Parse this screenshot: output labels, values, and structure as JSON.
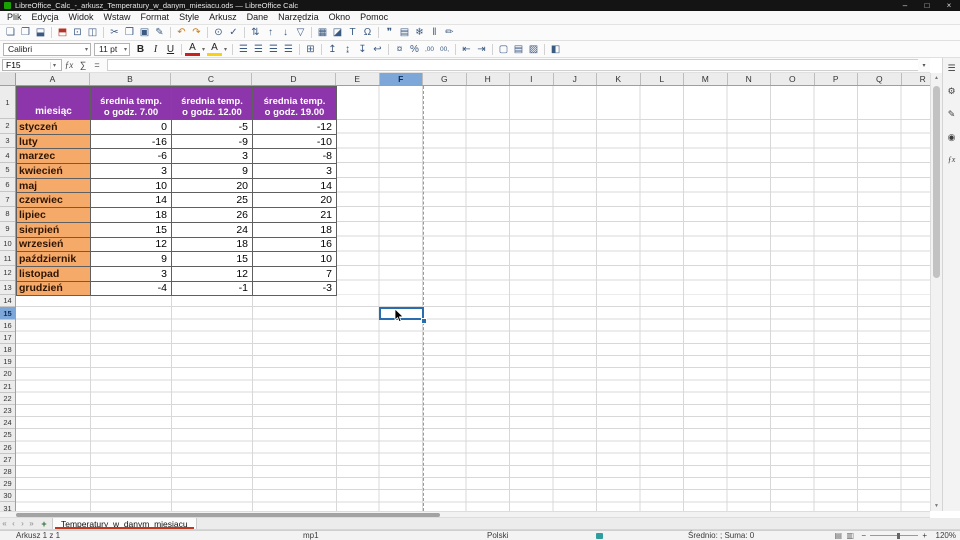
{
  "window": {
    "title": "LibreOffice_Calc_-_arkusz_Temperatury_w_danym_miesiacu.ods — LibreOffice Calc",
    "minimize": "–",
    "maximize": "□",
    "close": "×"
  },
  "menu": {
    "items": [
      "Plik",
      "Edycja",
      "Widok",
      "Wstaw",
      "Format",
      "Style",
      "Arkusz",
      "Dane",
      "Narzędzia",
      "Okno",
      "Pomoc"
    ]
  },
  "toolbar_main": {
    "items": [
      {
        "name": "new-document-icon",
        "glyph": "❏",
        "cls": "tbi",
        "i": "true"
      },
      {
        "name": "open-document-icon",
        "glyph": "❐",
        "cls": "tbi",
        "i": "true"
      },
      {
        "name": "save-document-icon",
        "glyph": "⬓",
        "cls": "tbi",
        "i": "true"
      },
      {
        "name": "separator",
        "glyph": "",
        "cls": "tbsep",
        "i": "false"
      },
      {
        "name": "export-pdf-icon",
        "glyph": "⬒",
        "cls": "tbi red",
        "i": "true"
      },
      {
        "name": "print-icon",
        "glyph": "⊡",
        "cls": "tbi",
        "i": "true"
      },
      {
        "name": "print-preview-icon",
        "glyph": "◫",
        "cls": "tbi",
        "i": "true"
      },
      {
        "name": "separator",
        "glyph": "",
        "cls": "tbsep",
        "i": "false"
      },
      {
        "name": "cut-icon",
        "glyph": "✂",
        "cls": "tbi",
        "i": "true"
      },
      {
        "name": "copy-icon",
        "glyph": "❒",
        "cls": "tbi",
        "i": "true"
      },
      {
        "name": "paste-icon",
        "glyph": "▣",
        "cls": "tbi",
        "i": "true"
      },
      {
        "name": "clone-formatting-icon",
        "glyph": "✎",
        "cls": "tbi",
        "i": "true"
      },
      {
        "name": "separator",
        "glyph": "",
        "cls": "tbsep",
        "i": "false"
      },
      {
        "name": "undo-icon",
        "glyph": "↶",
        "cls": "tbi amber",
        "i": "true"
      },
      {
        "name": "redo-icon",
        "glyph": "↷",
        "cls": "tbi amber",
        "i": "true"
      },
      {
        "name": "separator",
        "glyph": "",
        "cls": "tbsep",
        "i": "false"
      },
      {
        "name": "find-and-replace-icon",
        "glyph": "⊙",
        "cls": "tbi",
        "i": "true"
      },
      {
        "name": "spelling-icon",
        "glyph": "✓",
        "cls": "tbi",
        "i": "true"
      },
      {
        "name": "separator",
        "glyph": "",
        "cls": "tbsep",
        "i": "false"
      },
      {
        "name": "sort-icon",
        "glyph": "⇅",
        "cls": "tbi",
        "i": "true"
      },
      {
        "name": "sort-ascending-icon",
        "glyph": "↑",
        "cls": "tbi",
        "i": "true"
      },
      {
        "name": "sort-descending-icon",
        "glyph": "↓",
        "cls": "tbi",
        "i": "true"
      },
      {
        "name": "autofilter-icon",
        "glyph": "▽",
        "cls": "tbi",
        "i": "true"
      },
      {
        "name": "separator",
        "glyph": "",
        "cls": "tbsep",
        "i": "false"
      },
      {
        "name": "insert-image-icon",
        "glyph": "▦",
        "cls": "tbi",
        "i": "true"
      },
      {
        "name": "insert-chart-icon",
        "glyph": "◪",
        "cls": "tbi",
        "i": "true"
      },
      {
        "name": "insert-text-box-icon",
        "glyph": "T",
        "cls": "tbi",
        "i": "true"
      },
      {
        "name": "insert-special-character-icon",
        "glyph": "Ω",
        "cls": "tbi",
        "i": "true"
      },
      {
        "name": "separator",
        "glyph": "",
        "cls": "tbsep",
        "i": "false"
      },
      {
        "name": "insert-comment-icon",
        "glyph": "❞",
        "cls": "tbi",
        "i": "true"
      },
      {
        "name": "headers-and-footers-icon",
        "glyph": "▤",
        "cls": "tbi",
        "i": "true"
      },
      {
        "name": "freeze-rows-and-columns-icon",
        "glyph": "❄",
        "cls": "tbi",
        "i": "true"
      },
      {
        "name": "split-window-icon",
        "glyph": "‖",
        "cls": "tbi",
        "i": "true"
      },
      {
        "name": "show-draw-functions-icon",
        "glyph": "✏",
        "cls": "tbi",
        "i": "true"
      }
    ]
  },
  "toolbar_format": {
    "font_name": "Calibri",
    "font_size": "11 pt",
    "dropdown_arrow": "▾",
    "items": [
      {
        "name": "bold-icon",
        "glyph": "B",
        "cls": "tbi b",
        "i": "true"
      },
      {
        "name": "italic-icon",
        "glyph": "I",
        "cls": "tbi it",
        "i": "true"
      },
      {
        "name": "underline-icon",
        "glyph": "U",
        "cls": "tbi un",
        "i": "true"
      },
      {
        "name": "separator",
        "glyph": "",
        "cls": "tbsep",
        "i": "false"
      },
      {
        "name": "font-color-icon",
        "glyph": "A",
        "cls": "tbi fc",
        "i": "true"
      },
      {
        "name": "font-color-dropdown",
        "glyph": "▾",
        "cls": "tbarr",
        "i": "true"
      },
      {
        "name": "highlighting-color-icon",
        "glyph": "A",
        "cls": "tbi hl",
        "i": "true"
      },
      {
        "name": "highlighting-color-dropdown",
        "glyph": "▾",
        "cls": "tbarr",
        "i": "true"
      },
      {
        "name": "separator",
        "glyph": "",
        "cls": "tbsep",
        "i": "false"
      },
      {
        "name": "align-left-icon",
        "glyph": "☰",
        "cls": "tbi",
        "i": "true"
      },
      {
        "name": "align-center-icon",
        "glyph": "☰",
        "cls": "tbi",
        "i": "true"
      },
      {
        "name": "align-right-icon",
        "glyph": "☰",
        "cls": "tbi",
        "i": "true"
      },
      {
        "name": "justified-icon",
        "glyph": "☰",
        "cls": "tbi",
        "i": "true"
      },
      {
        "name": "separator",
        "glyph": "",
        "cls": "tbsep",
        "i": "false"
      },
      {
        "name": "merge-cells-icon",
        "glyph": "⊞",
        "cls": "tbi",
        "i": "true"
      },
      {
        "name": "separator",
        "glyph": "",
        "cls": "tbsep",
        "i": "false"
      },
      {
        "name": "align-top-icon",
        "glyph": "↥",
        "cls": "tbi",
        "i": "true"
      },
      {
        "name": "center-vertically-icon",
        "glyph": "↨",
        "cls": "tbi",
        "i": "true"
      },
      {
        "name": "align-bottom-icon",
        "glyph": "↧",
        "cls": "tbi",
        "i": "true"
      },
      {
        "name": "wrap-text-icon",
        "glyph": "↩",
        "cls": "tbi",
        "i": "true"
      },
      {
        "name": "separator",
        "glyph": "",
        "cls": "tbsep",
        "i": "false"
      },
      {
        "name": "format-as-currency-icon",
        "glyph": "¤",
        "cls": "tbi",
        "i": "true"
      },
      {
        "name": "format-as-percent-icon",
        "glyph": "%",
        "cls": "tbi",
        "i": "true"
      },
      {
        "name": "add-decimal-place-icon",
        "glyph": ",00",
        "cls": "tbi sm",
        "i": "true"
      },
      {
        "name": "delete-decimal-place-icon",
        "glyph": "00,",
        "cls": "tbi sm",
        "i": "true"
      },
      {
        "name": "separator",
        "glyph": "",
        "cls": "tbsep",
        "i": "false"
      },
      {
        "name": "decrease-indent-icon",
        "glyph": "⇤",
        "cls": "tbi",
        "i": "true"
      },
      {
        "name": "increase-indent-icon",
        "glyph": "⇥",
        "cls": "tbi",
        "i": "true"
      },
      {
        "name": "separator",
        "glyph": "",
        "cls": "tbsep",
        "i": "false"
      },
      {
        "name": "borders-icon",
        "glyph": "▢",
        "cls": "tbi",
        "i": "true"
      },
      {
        "name": "border-style-icon",
        "glyph": "▤",
        "cls": "tbi",
        "i": "true"
      },
      {
        "name": "border-color-icon",
        "glyph": "▨",
        "cls": "tbi",
        "i": "true"
      },
      {
        "name": "separator",
        "glyph": "",
        "cls": "tbsep",
        "i": "false"
      },
      {
        "name": "conditional-formatting-icon",
        "glyph": "◧",
        "cls": "tbi",
        "i": "true"
      }
    ]
  },
  "formula_bar": {
    "name_box": "F15",
    "dropdown_arrow": "▾",
    "function_wizard": "ƒx",
    "sum": "∑",
    "formula": "=",
    "input_value": "",
    "expand_arrow": "▾"
  },
  "grid": {
    "cols_abcd": [
      "A",
      "B",
      "C",
      "D"
    ],
    "cols_uniform": [
      {
        "label": "E",
        "cls": "ch u",
        "name": "column-header-E"
      },
      {
        "label": "F",
        "cls": "ch u sel",
        "name": "column-header-F"
      },
      {
        "label": "G",
        "cls": "ch u",
        "name": "column-header-G"
      },
      {
        "label": "H",
        "cls": "ch u",
        "name": "column-header-H"
      },
      {
        "label": "I",
        "cls": "ch u",
        "name": "column-header-I"
      },
      {
        "label": "J",
        "cls": "ch u",
        "name": "column-header-J"
      },
      {
        "label": "K",
        "cls": "ch u",
        "name": "column-header-K"
      },
      {
        "label": "L",
        "cls": "ch u",
        "name": "column-header-L"
      },
      {
        "label": "M",
        "cls": "ch u",
        "name": "column-header-M"
      },
      {
        "label": "N",
        "cls": "ch u",
        "name": "column-header-N"
      },
      {
        "label": "O",
        "cls": "ch u",
        "name": "column-header-O"
      },
      {
        "label": "P",
        "cls": "ch u",
        "name": "column-header-P"
      },
      {
        "label": "Q",
        "cls": "ch u",
        "name": "column-header-Q"
      },
      {
        "label": "R",
        "cls": "ch u",
        "name": "column-header-R"
      }
    ],
    "row1": "1",
    "rows_data": [
      "2",
      "3",
      "4",
      "5",
      "6",
      "7",
      "8",
      "9",
      "10",
      "11",
      "12",
      "13"
    ],
    "rows_empty": [
      {
        "label": "14",
        "cls": "rh e",
        "name": "row-header-14"
      },
      {
        "label": "15",
        "cls": "rh e sel",
        "name": "row-header-15"
      },
      {
        "label": "16",
        "cls": "rh e",
        "name": "row-header-16"
      },
      {
        "label": "17",
        "cls": "rh e",
        "name": "row-header-17"
      },
      {
        "label": "18",
        "cls": "rh e",
        "name": "row-header-18"
      },
      {
        "label": "19",
        "cls": "rh e",
        "name": "row-header-19"
      },
      {
        "label": "20",
        "cls": "rh e",
        "name": "row-header-20"
      },
      {
        "label": "21",
        "cls": "rh e",
        "name": "row-header-21"
      },
      {
        "label": "22",
        "cls": "rh e",
        "name": "row-header-22"
      },
      {
        "label": "23",
        "cls": "rh e",
        "name": "row-header-23"
      },
      {
        "label": "24",
        "cls": "rh e",
        "name": "row-header-24"
      },
      {
        "label": "25",
        "cls": "rh e",
        "name": "row-header-25"
      },
      {
        "label": "26",
        "cls": "rh e",
        "name": "row-header-26"
      },
      {
        "label": "27",
        "cls": "rh e",
        "name": "row-header-27"
      },
      {
        "label": "28",
        "cls": "rh e",
        "name": "row-header-28"
      },
      {
        "label": "29",
        "cls": "rh e",
        "name": "row-header-29"
      },
      {
        "label": "30",
        "cls": "rh e",
        "name": "row-header-30"
      },
      {
        "label": "31",
        "cls": "rh e",
        "name": "row-header-31"
      }
    ]
  },
  "sheet_table": {
    "corner_header": "miesiąc",
    "col_headers": [
      "średnia temp.\no godz. 7.00",
      "średnia temp.\no godz. 12.00",
      "średnia temp.\no godz. 19.00"
    ],
    "rows": [
      {
        "month": "styczeń",
        "t7": "0",
        "t12": "-5",
        "t19": "-12"
      },
      {
        "month": "luty",
        "t7": "-16",
        "t12": "-9",
        "t19": "-10"
      },
      {
        "month": "marzec",
        "t7": "-6",
        "t12": "3",
        "t19": "-8"
      },
      {
        "month": "kwiecień",
        "t7": "3",
        "t12": "9",
        "t19": "3"
      },
      {
        "month": "maj",
        "t7": "10",
        "t12": "20",
        "t19": "14"
      },
      {
        "month": "czerwiec",
        "t7": "14",
        "t12": "25",
        "t19": "20"
      },
      {
        "month": "lipiec",
        "t7": "18",
        "t12": "26",
        "t19": "21"
      },
      {
        "month": "sierpień",
        "t7": "15",
        "t12": "24",
        "t19": "18"
      },
      {
        "month": "wrzesień",
        "t7": "12",
        "t12": "18",
        "t19": "16"
      },
      {
        "month": "październik",
        "t7": "9",
        "t12": "15",
        "t19": "10"
      },
      {
        "month": "listopad",
        "t7": "3",
        "t12": "12",
        "t19": "7"
      },
      {
        "month": "grudzień",
        "t7": "-4",
        "t12": "-1",
        "t19": "-3"
      }
    ]
  },
  "selection": {
    "cell_ref": "F15"
  },
  "scrollbars": {
    "up": "▲",
    "down": "▼"
  },
  "sidebar": {
    "items": [
      {
        "name": "sidebar-settings-icon",
        "glyph": "☰",
        "cls": "sbicon"
      },
      {
        "name": "properties-icon",
        "glyph": "⚙",
        "cls": "sbicon"
      },
      {
        "name": "styles-icon",
        "glyph": "✎",
        "cls": "sbicon"
      },
      {
        "name": "navigator-icon",
        "glyph": "◉",
        "cls": "sbicon"
      },
      {
        "name": "functions-icon",
        "glyph": "ƒx",
        "cls": "sbicon fx"
      }
    ]
  },
  "sheet_tabs": {
    "nav_first": "«",
    "nav_prev": "‹",
    "nav_next": "›",
    "nav_last": "»",
    "add_sheet": "+",
    "active_tab": "Temperatury_w_danym_miesiacu"
  },
  "status_bar": {
    "sheet_info": "Arkusz 1 z 1",
    "page_style": "mp1",
    "language": "Polski",
    "summary": "Średnio: ; Suma: 0",
    "zoom_minus": "−",
    "zoom_plus": "+",
    "zoom_level": "120%"
  },
  "colors": {
    "header_purple": "#8d35ab",
    "month_orange": "#f5aa6a",
    "selection_blue": "#2a6daf",
    "active_tab_underline": "#c5351b",
    "selected_header_blue": "#7da7d8"
  }
}
